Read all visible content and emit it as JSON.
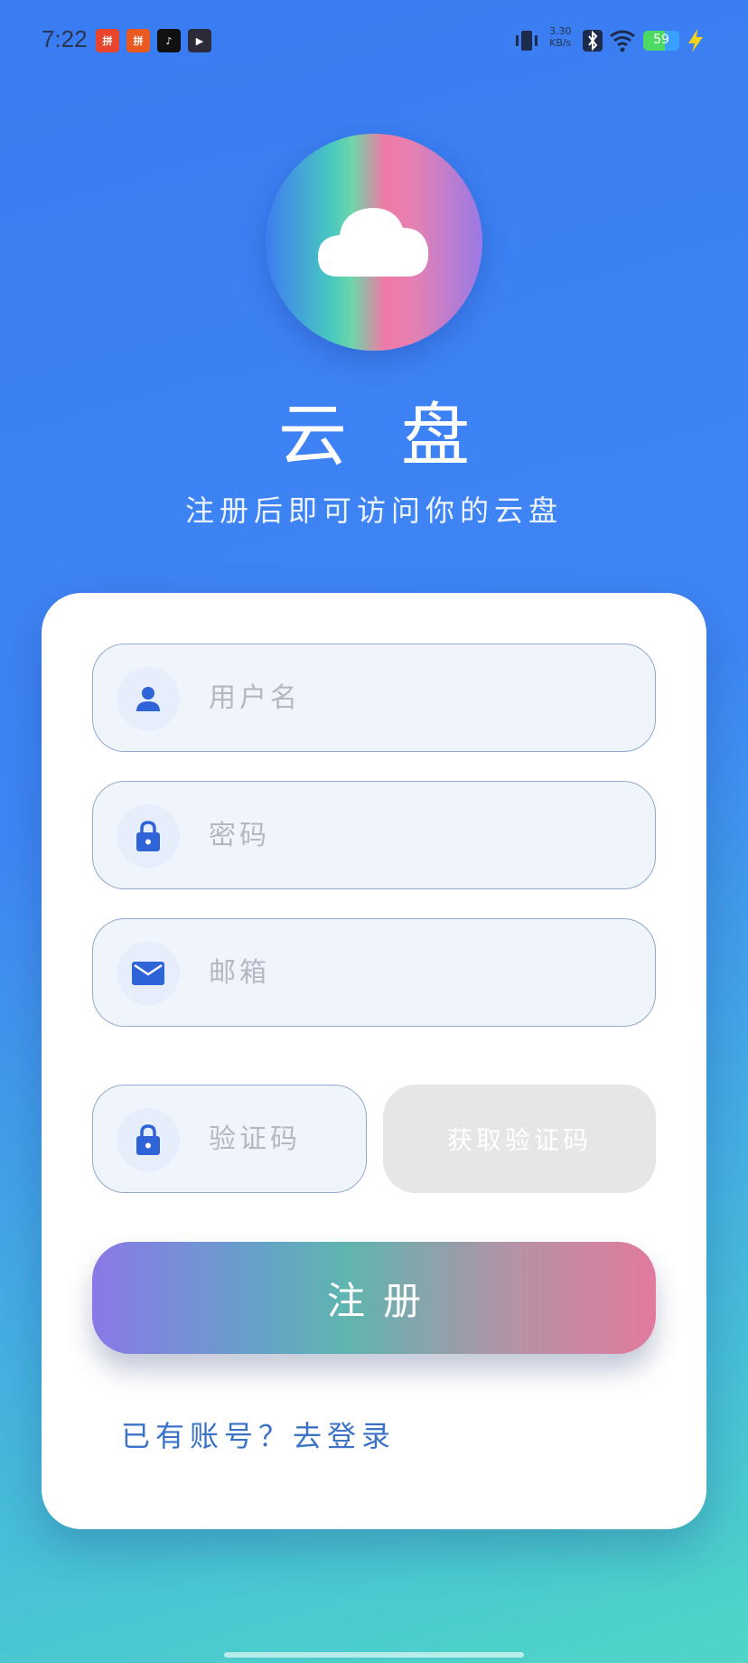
{
  "status_bar": {
    "time": "7:22",
    "net_speed_value": "3.30",
    "net_speed_unit": "KB/s",
    "battery_level": "59",
    "apps": [
      {
        "icon": "shopping-app-icon",
        "label": "拼",
        "color": "#e8452c"
      },
      {
        "icon": "shopping-app-icon",
        "label": "拼",
        "color": "#e85a20"
      },
      {
        "icon": "music-app-icon",
        "label": "♪",
        "color": "#111111"
      },
      {
        "icon": "video-app-icon",
        "label": "▶",
        "color": "#2b2b3a"
      }
    ]
  },
  "header": {
    "title": "云盘",
    "subtitle": "注册后即可访问你的云盘"
  },
  "form": {
    "username": {
      "placeholder": "用户名",
      "value": ""
    },
    "password": {
      "placeholder": "密码",
      "value": ""
    },
    "email": {
      "placeholder": "邮箱",
      "value": ""
    },
    "code": {
      "placeholder": "验证码",
      "value": ""
    },
    "get_code_label": "获取验证码",
    "submit_label": "注册",
    "login_link": "已有账号？去登录"
  },
  "colors": {
    "accent": "#2f63d8",
    "card_bg": "#ffffff",
    "field_border": "#93a9cf"
  }
}
